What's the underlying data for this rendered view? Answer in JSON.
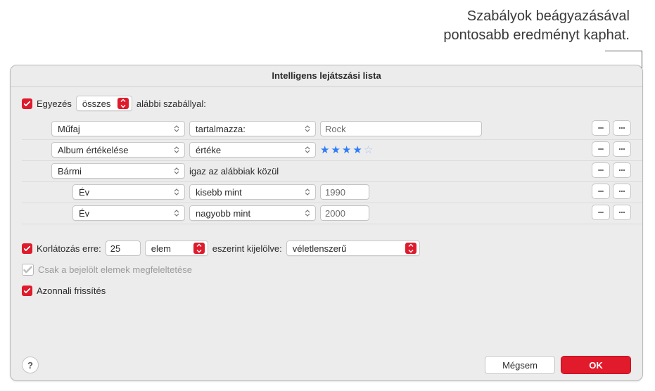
{
  "annotation": {
    "line1": "Szabályok beágyazásával",
    "line2": "pontosabb eredményt kaphat."
  },
  "dialog": {
    "title": "Intelligens lejátszási lista"
  },
  "match": {
    "checkbox": true,
    "pre_label": "Egyezés",
    "mode": "összes",
    "post_label": "alábbi szabállyal:"
  },
  "rules": [
    {
      "field": "Műfaj",
      "op": "tartalmazza:",
      "value_type": "text",
      "value": "Rock"
    },
    {
      "field": "Album értékelése",
      "op": "értéke",
      "value_type": "stars",
      "stars_filled": 4,
      "stars_total": 5
    },
    {
      "field": "Bármi",
      "op_text": "igaz az alábbiak közül",
      "value_type": "group"
    },
    {
      "indent": true,
      "field": "Év",
      "op": "kisebb mint",
      "value_type": "text",
      "value": "1990"
    },
    {
      "indent": true,
      "field": "Év",
      "op": "nagyobb mint",
      "value_type": "text",
      "value": "2000"
    }
  ],
  "limit": {
    "checkbox": true,
    "label": "Korlátozás erre:",
    "count": "25",
    "unit": "elem",
    "selected_by_label": "eszerint kijelölve:",
    "selected_by_value": "véletlenszerű"
  },
  "only_checked": {
    "checkbox": false,
    "label": "Csak a bejelölt elemek megfeleltetése"
  },
  "live_update": {
    "checkbox": true,
    "label": "Azonnali frissítés"
  },
  "buttons": {
    "help": "?",
    "cancel": "Mégsem",
    "ok": "OK"
  }
}
